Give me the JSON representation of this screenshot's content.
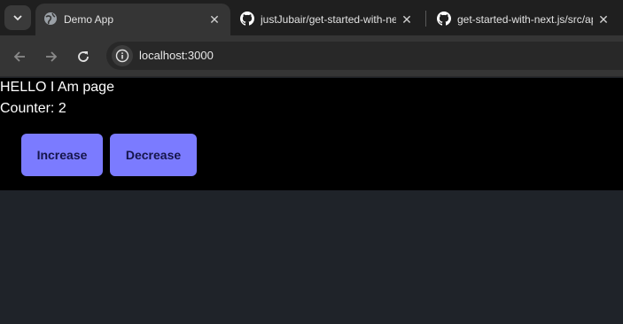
{
  "browser": {
    "tabs": [
      {
        "title": "Demo App",
        "favicon": "globe-icon",
        "active": true
      },
      {
        "title": "justJubair/get-started-with-next.js",
        "favicon": "github-icon",
        "active": false
      },
      {
        "title": "get-started-with-next.js/src/app",
        "favicon": "github-icon",
        "active": false
      }
    ],
    "close_glyph": "✕",
    "address": "localhost:3000"
  },
  "page": {
    "heading": "HELLO I Am page",
    "counter_text": "Counter: 2",
    "increase_label": "Increase",
    "decrease_label": "Decrease"
  },
  "colors": {
    "button_bg": "#7b7bff",
    "button_text": "#15154a",
    "page_bg": "#000000",
    "empty_area": "#1f2329"
  }
}
